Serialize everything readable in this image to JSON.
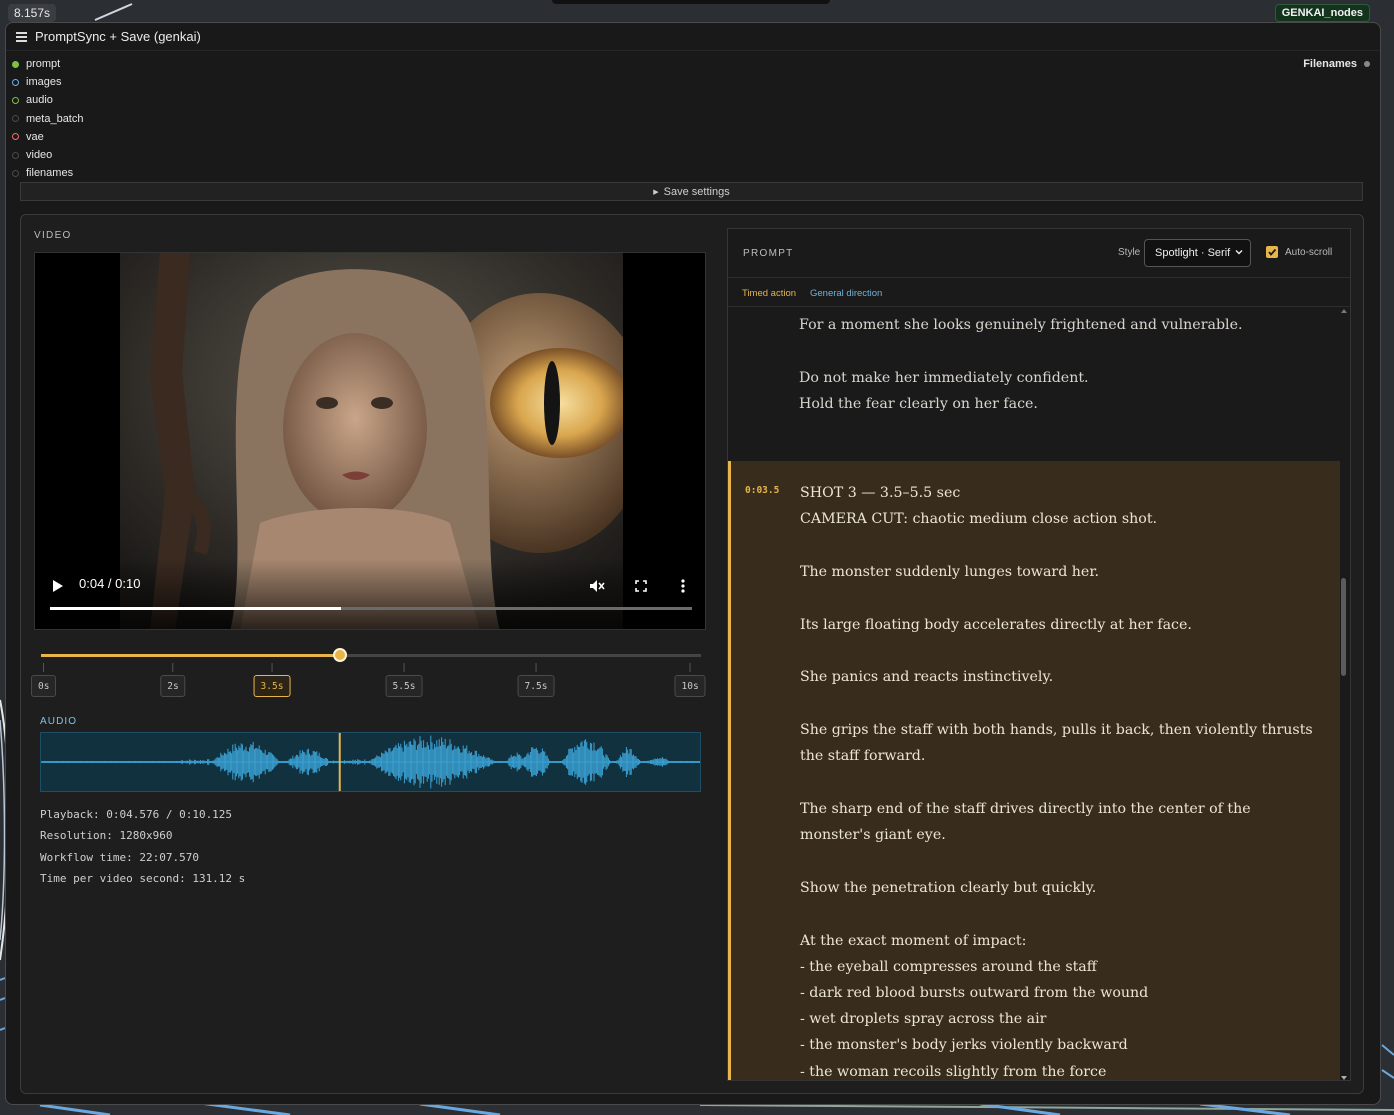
{
  "canvas": {
    "time_badge": "8.157s",
    "tag_badge": "GENKAI_nodes"
  },
  "node": {
    "title": "PromptSync + Save (genkai)",
    "inputs": [
      {
        "label": "prompt",
        "color": "#7cc344"
      },
      {
        "label": "images",
        "color": "#64b5f6"
      },
      {
        "label": "audio",
        "color": "#7cc344"
      },
      {
        "label": "meta_batch",
        "color": "#4a4a4a"
      },
      {
        "label": "vae",
        "color": "#ff6b6b"
      },
      {
        "label": "video",
        "color": "#4a4a4a"
      },
      {
        "label": "filenames",
        "color": "#4a4a4a"
      }
    ],
    "output_label": "Filenames",
    "save_settings_label": "Save settings"
  },
  "video": {
    "section_label": "VIDEO",
    "time_display": "0:04 / 0:10",
    "progress_fraction": 0.453,
    "scrub_fraction": 0.453,
    "ticks": [
      {
        "label": "0s",
        "value": 0
      },
      {
        "label": "2s",
        "value": 2
      },
      {
        "label": "3.5s",
        "value": 3.5,
        "active": true
      },
      {
        "label": "5.5s",
        "value": 5.5
      },
      {
        "label": "7.5s",
        "value": 7.5
      },
      {
        "label": "10s",
        "value": 10
      }
    ],
    "duration": 10.125,
    "playhead": 4.576
  },
  "audio": {
    "section_label": "AUDIO"
  },
  "stats": {
    "playback": "Playback: 0:04.576 / 0:10.125",
    "resolution": "Resolution: 1280x960",
    "workflow_time": "Workflow time: 22:07.570",
    "time_per_second": "Time per video second: 131.12 s"
  },
  "prompt_panel": {
    "title": "PROMPT",
    "style_label": "Style",
    "style_value": "Spotlight · Serif",
    "autoscroll_label": "Auto-scroll",
    "autoscroll_checked": true,
    "legend_timed": "Timed action",
    "legend_general": "General direction",
    "accent_color": "#e8b54a",
    "previous_segment": {
      "lines": [
        "For a moment she looks genuinely frightened and vulnerable.",
        "Do not make her immediately confident.",
        "Hold the fear clearly on her face."
      ]
    },
    "active_segment": {
      "timestamp": "0:03.5",
      "heading": "SHOT 3 — 3.5–5.5 sec",
      "camera": "CAMERA CUT: chaotic medium close action shot.",
      "paragraphs": [
        "The monster suddenly lunges toward her.",
        "Its large floating body accelerates directly at her face.",
        "She panics and reacts instinctively.",
        "She grips the staff with both hands, pulls it back, then violently thrusts the staff forward.",
        "The sharp end of the staff drives directly into the center of the monster's giant eye.",
        "Show the penetration clearly but quickly."
      ],
      "impact_intro": "At the exact moment of impact:",
      "impact_list": [
        "- the eyeball compresses around the staff",
        "- dark red blood bursts outward from the wound",
        "- wet droplets spray across the air",
        "- the monster's body jerks violently backward",
        "- the woman recoils slightly from the force"
      ]
    }
  }
}
